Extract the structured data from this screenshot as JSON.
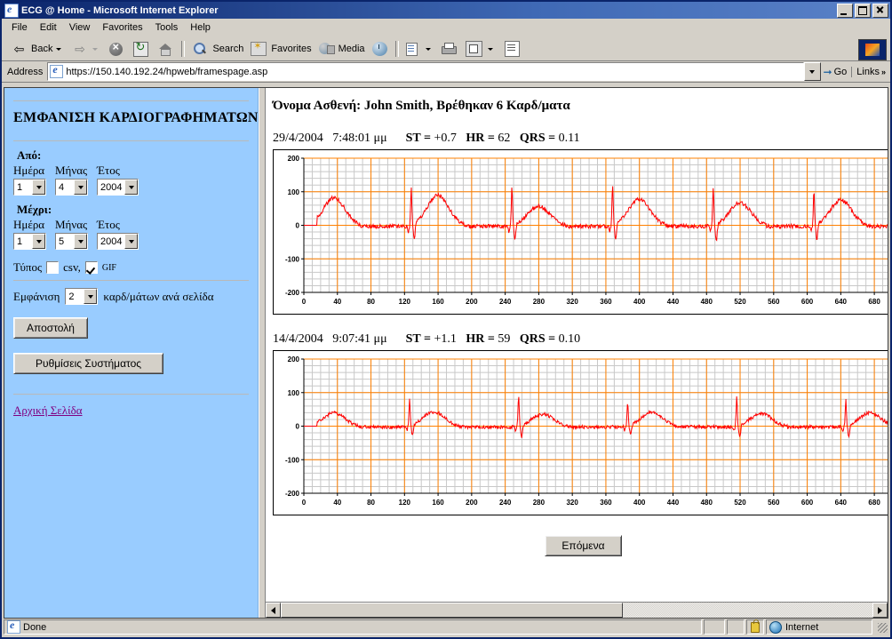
{
  "window": {
    "title": "ECG @ Home - Microsoft Internet Explorer",
    "minimize": "–",
    "maximize": "□",
    "close": "×"
  },
  "menu": [
    "File",
    "Edit",
    "View",
    "Favorites",
    "Tools",
    "Help"
  ],
  "toolbar": {
    "back": "Back",
    "search": "Search",
    "favorites": "Favorites",
    "media": "Media"
  },
  "address": {
    "label": "Address",
    "url": "https://150.140.192.24/hpweb/framespage.asp",
    "go": "Go",
    "links": "Links",
    "chevron": "»"
  },
  "sidebar": {
    "title": "ΕΜΦΑΝΙΣΗ ΚΑΡΔΙΟΓΡΑΦΗΜΑΤΩΝ",
    "from_label": "Από:",
    "to_label": "Μέχρι:",
    "day_label": "Ημέρα",
    "month_label": "Μήνας",
    "year_label": "Έτος",
    "from": {
      "day": "1",
      "month": "4",
      "year": "2004"
    },
    "to": {
      "day": "1",
      "month": "5",
      "year": "2004"
    },
    "type_label": "Τύπος",
    "type_csv": "csv,",
    "type_gif": "GIF",
    "csv_checked": false,
    "gif_checked": true,
    "display_label": "Εμφάνιση",
    "display_count": "2",
    "display_suffix": "καρδ/μάτων ανά σελίδα",
    "submit_button": "Αποστολή",
    "settings_button": "Ρυθμίσεις Συστήματος",
    "home_link": "Αρχική Σελίδα"
  },
  "main": {
    "patient_line": "Όνομα Ασθενή: John Smith, Βρέθηκαν 6 Καρδ/ματα",
    "next_button": "Επόμενα"
  },
  "status": {
    "message": "Done",
    "zone": "Internet"
  },
  "chart_data": [
    {
      "type": "line",
      "title": "29/4/2004 7:48:01 μμ",
      "date": "29/4/2004",
      "time": "7:48:01 μμ",
      "st_label": "ST =",
      "st_value": "+0.7",
      "hr_label": "HR =",
      "hr_value": "62",
      "qrs_label": "QRS =",
      "qrs_value": "0.11",
      "xlabel": "",
      "ylabel": "",
      "xlim": [
        0,
        700
      ],
      "ylim": [
        -200,
        200
      ],
      "xticks": [
        0,
        40,
        80,
        120,
        160,
        200,
        240,
        280,
        320,
        360,
        400,
        440,
        480,
        520,
        560,
        600,
        640,
        680
      ],
      "yticks": [
        -200,
        -100,
        0,
        100,
        200
      ],
      "grid": true,
      "major_grid_color": "#ff8000",
      "minor_grid_color": "#c8c8c8",
      "line_color": "#ff0000",
      "beat_peaks_x": [
        128,
        248,
        368,
        488,
        608
      ],
      "beat_peaks_y": [
        118,
        118,
        122,
        118,
        112
      ],
      "t_wave_peaks_x": [
        36,
        160,
        280,
        400,
        520,
        640
      ],
      "t_wave_peaks_y": [
        85,
        92,
        60,
        80,
        70,
        78
      ],
      "baseline": 0,
      "noise_amplitude": 12
    },
    {
      "type": "line",
      "title": "14/4/2004 9:07:41 μμ",
      "date": "14/4/2004",
      "time": "9:07:41 μμ",
      "st_label": "ST =",
      "st_value": "+1.1",
      "hr_label": "HR =",
      "hr_value": "59",
      "qrs_label": "QRS =",
      "qrs_value": "0.10",
      "xlabel": "",
      "ylabel": "",
      "xlim": [
        0,
        700
      ],
      "ylim": [
        -200,
        200
      ],
      "xticks": [
        0,
        40,
        80,
        120,
        160,
        200,
        240,
        280,
        320,
        360,
        400,
        440,
        480,
        520,
        560,
        600,
        640,
        680
      ],
      "yticks": [
        -200,
        -100,
        0,
        100,
        200
      ],
      "grid": true,
      "major_grid_color": "#ff8000",
      "minor_grid_color": "#c8c8c8",
      "line_color": "#ff0000",
      "beat_peaks_x": [
        126,
        256,
        386,
        516,
        646
      ],
      "beat_peaks_y": [
        78,
        88,
        72,
        86,
        80
      ],
      "t_wave_peaks_x": [
        36,
        155,
        285,
        415,
        545,
        675
      ],
      "t_wave_peaks_y": [
        42,
        45,
        38,
        44,
        40,
        42
      ],
      "baseline": 0,
      "noise_amplitude": 10
    }
  ]
}
